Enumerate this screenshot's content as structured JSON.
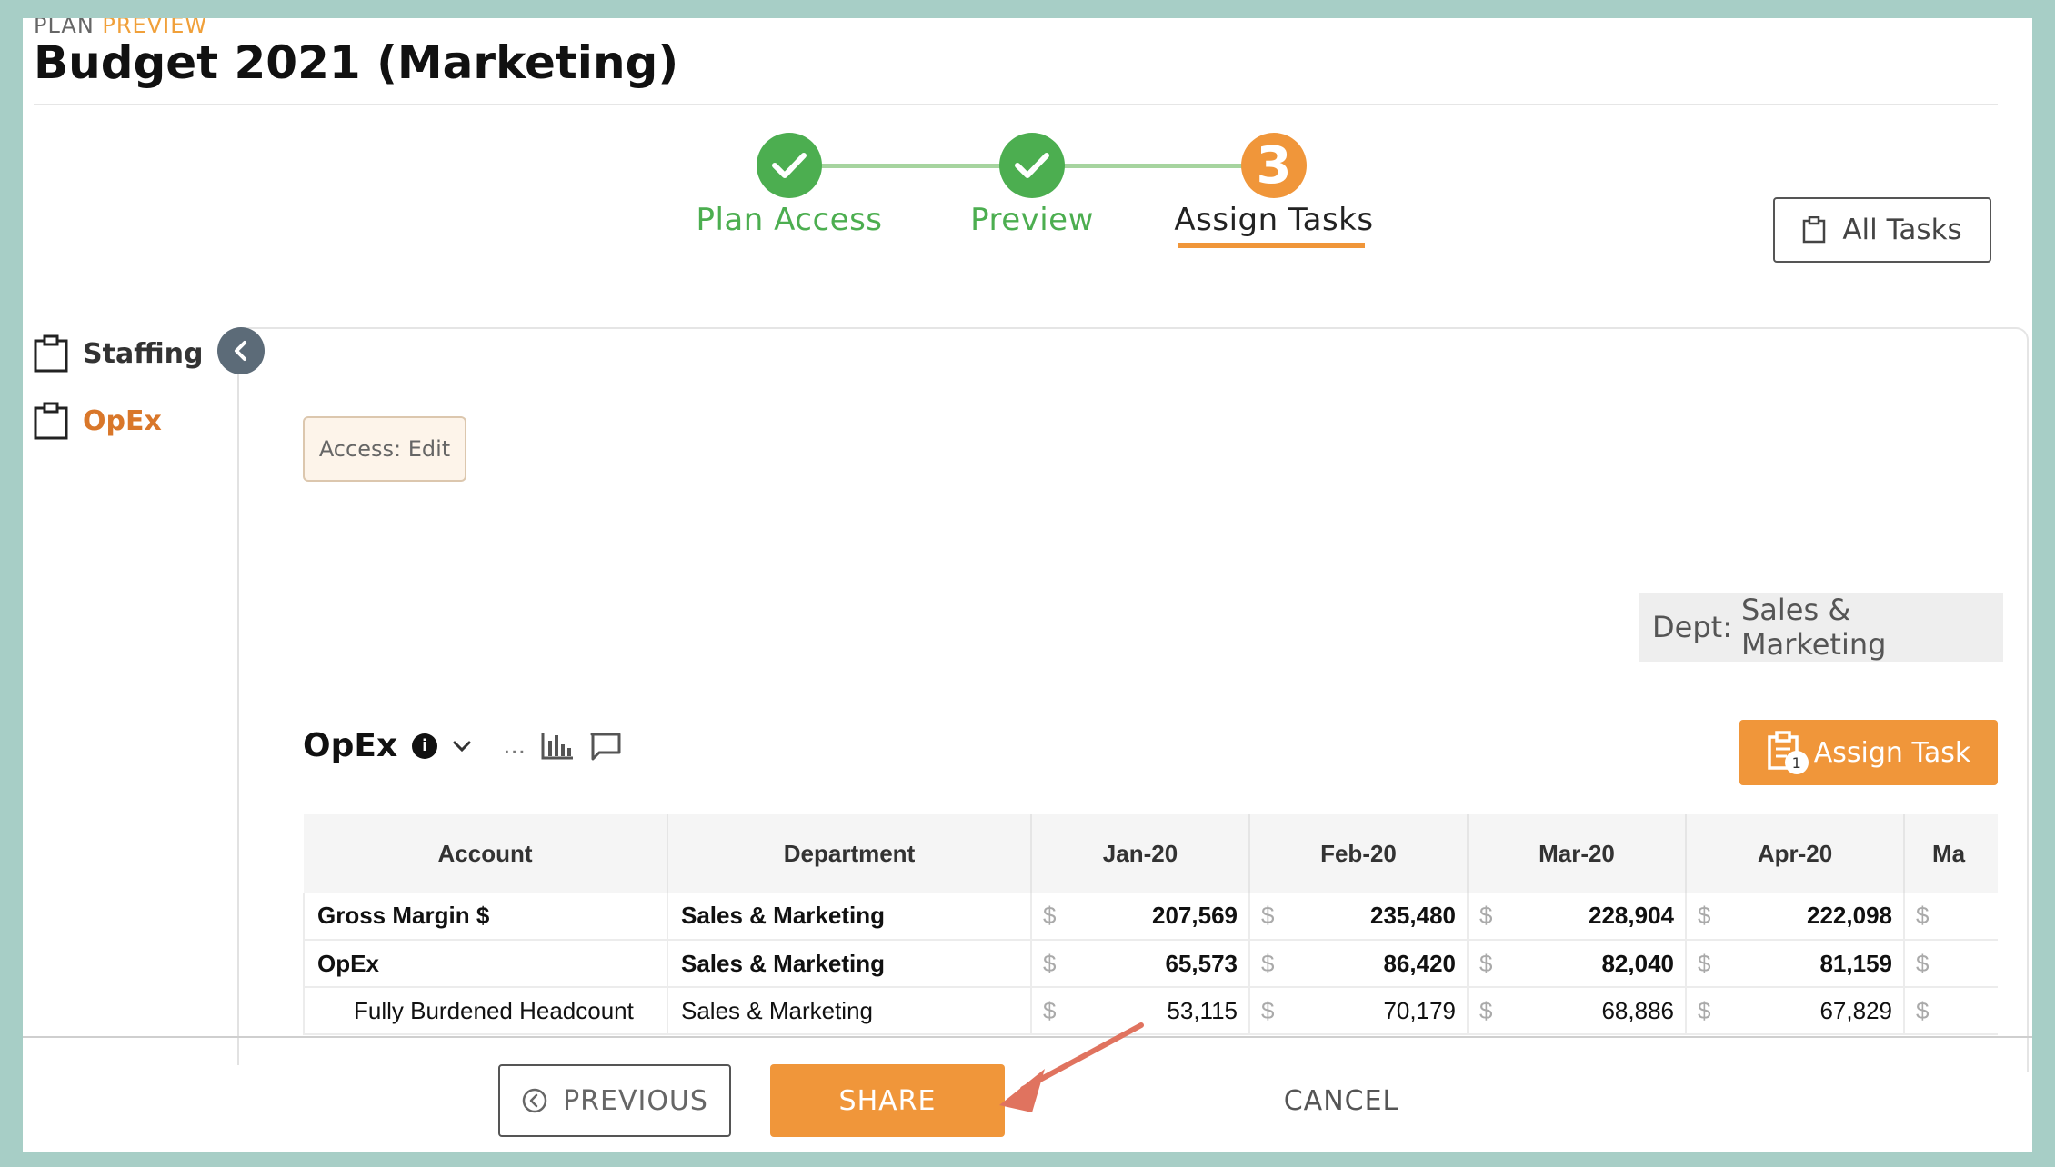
{
  "header": {
    "breadcrumb_prefix": "PLAN",
    "breadcrumb_current": "PREVIEW",
    "title": "Budget 2021 (Marketing)"
  },
  "stepper": {
    "steps": [
      {
        "label": "Plan Access",
        "state": "done"
      },
      {
        "label": "Preview",
        "state": "done"
      },
      {
        "label": "Assign Tasks",
        "state": "active",
        "number": "3"
      }
    ]
  },
  "all_tasks_label": "All Tasks",
  "sidebar": {
    "items": [
      {
        "label": "Staffing",
        "icon": "clipboard-icon"
      },
      {
        "label": "OpEx",
        "icon": "clipboard-icon",
        "active": true
      }
    ]
  },
  "access_badge": "Access: Edit",
  "dept_filter": {
    "label": "Dept:",
    "value": "Sales & Marketing"
  },
  "section": {
    "title": "OpEx",
    "more": "...",
    "assign_task_label": "Assign Task",
    "assign_task_badge": "1"
  },
  "table": {
    "headers": [
      "Account",
      "Department",
      "Jan-20",
      "Feb-20",
      "Mar-20",
      "Apr-20",
      "Ma"
    ],
    "rows": [
      {
        "account": "Gross Margin $",
        "department": "Sales & Marketing",
        "values": [
          "207,569",
          "235,480",
          "228,904",
          "222,098"
        ]
      },
      {
        "account": "OpEx",
        "department": "Sales & Marketing",
        "values": [
          "65,573",
          "86,420",
          "82,040",
          "81,159"
        ]
      },
      {
        "account": "Fully Burdened Headcount",
        "department": "Sales & Marketing",
        "values": [
          "53,115",
          "70,179",
          "68,886",
          "67,829"
        ]
      }
    ],
    "currency": "$"
  },
  "footer": {
    "previous_label": "PREVIOUS",
    "share_label": "SHARE",
    "cancel_label": "CANCEL"
  },
  "colors": {
    "accent": "#f0963a",
    "success": "#4cae50",
    "frame": "#a7cec6"
  }
}
